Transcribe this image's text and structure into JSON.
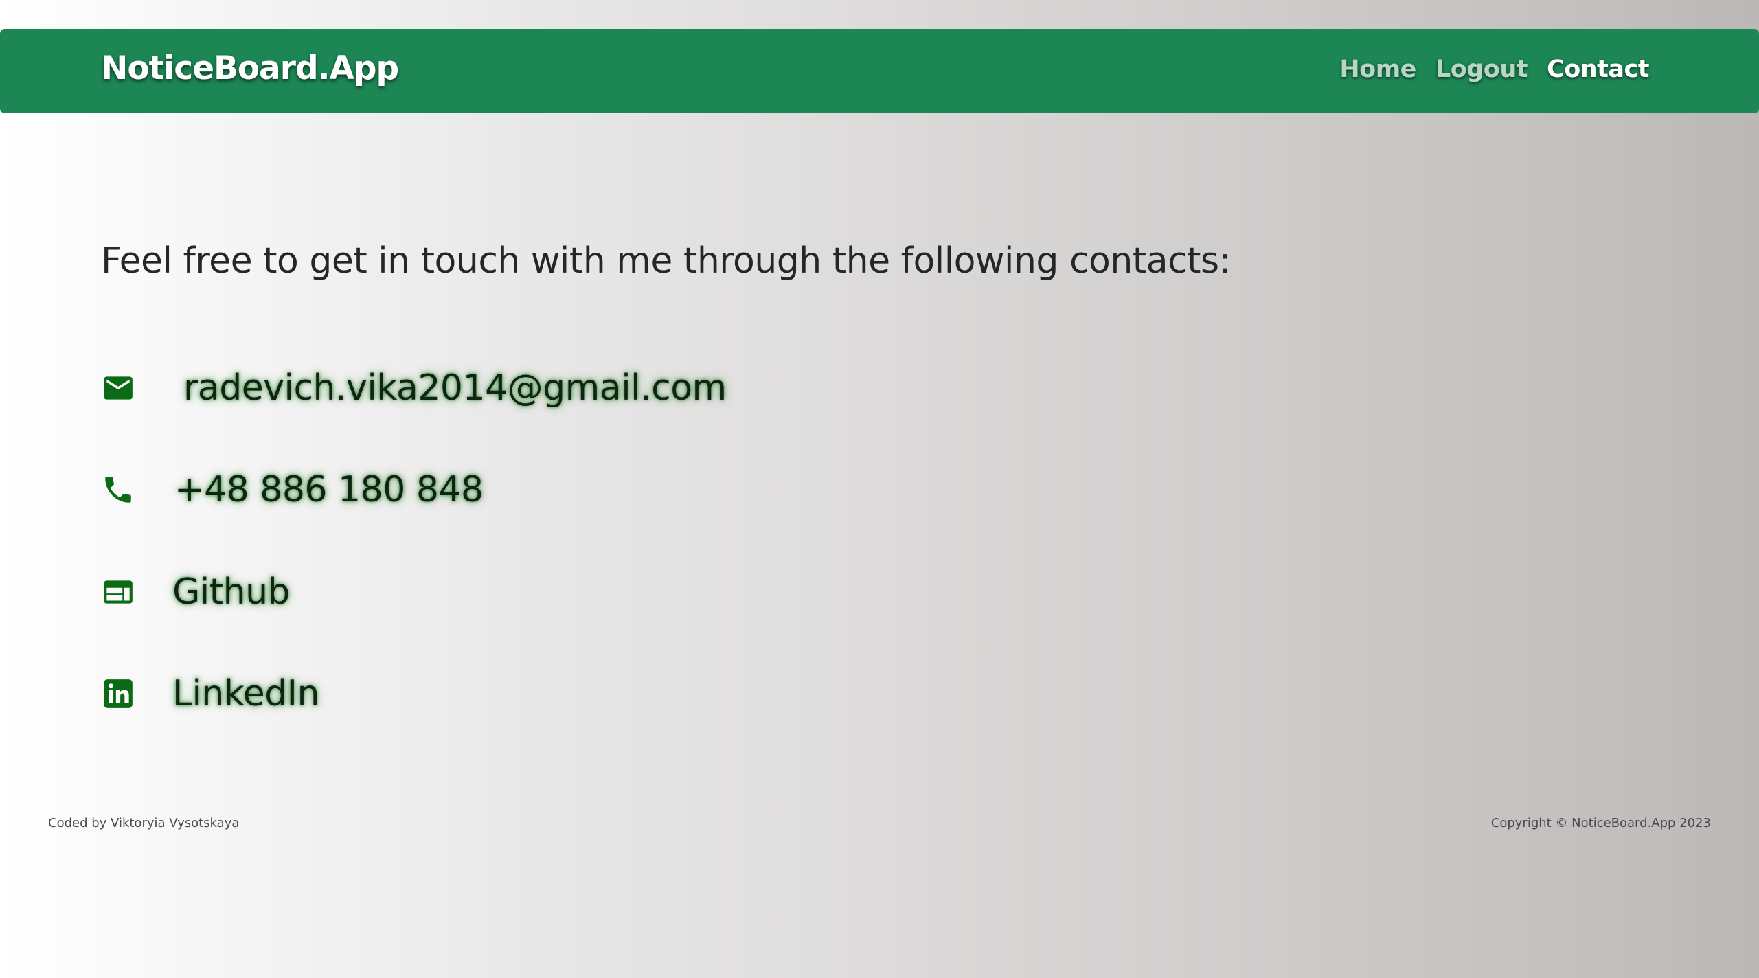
{
  "header": {
    "brand": "NoticeBoard.App",
    "nav": [
      {
        "label": "Home",
        "active": false
      },
      {
        "label": "Logout",
        "active": false
      },
      {
        "label": "Contact",
        "active": true
      }
    ]
  },
  "main": {
    "intro": "Feel free to get in touch with me through the following contacts:",
    "contacts": [
      {
        "icon": "email-icon",
        "text": "radevich.vika2014@gmail.com"
      },
      {
        "icon": "phone-icon",
        "text": "+48 886 180 848"
      },
      {
        "icon": "web-icon",
        "text": "Github"
      },
      {
        "icon": "linkedin-icon",
        "text": "LinkedIn"
      }
    ]
  },
  "footer": {
    "credit": "Coded by Viktoryia Vysotskaya",
    "copyright": "Copyright © NoticeBoard.App 2023"
  },
  "colors": {
    "navbar": "#1c8754",
    "icon": "#0b6b14",
    "contact_glow": "#147814"
  }
}
